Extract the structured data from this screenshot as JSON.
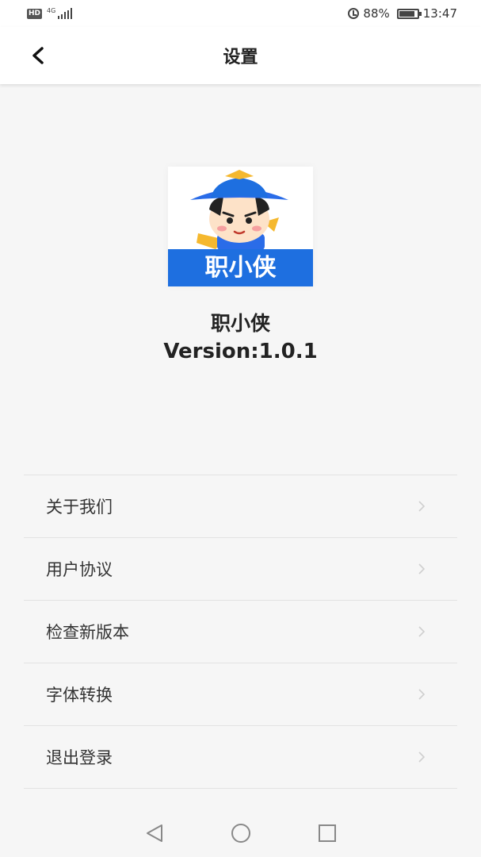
{
  "status_bar": {
    "hd_badge": "HD",
    "network_tag": "4G",
    "battery_percent": "88%",
    "battery_level": 0.88,
    "time": "13:47",
    "icons": [
      "signal-icon",
      "alarm-icon",
      "battery-icon"
    ]
  },
  "header": {
    "title": "设置",
    "back_icon": "chevron-left-icon"
  },
  "app": {
    "logo_text": "职小侠",
    "name": "职小侠",
    "version": "Version:1.0.1",
    "colors": {
      "logo_blue": "#1e6fe0",
      "hat_blue": "#2a6ce8",
      "hat_gold": "#f5b82e"
    }
  },
  "menu": {
    "items": [
      {
        "label": "关于我们"
      },
      {
        "label": "用户协议"
      },
      {
        "label": "检查新版本"
      },
      {
        "label": "字体转换"
      },
      {
        "label": "退出登录"
      }
    ]
  },
  "nav_bar": {
    "icons": [
      "back-triangle-icon",
      "home-circle-icon",
      "recents-square-icon"
    ]
  }
}
